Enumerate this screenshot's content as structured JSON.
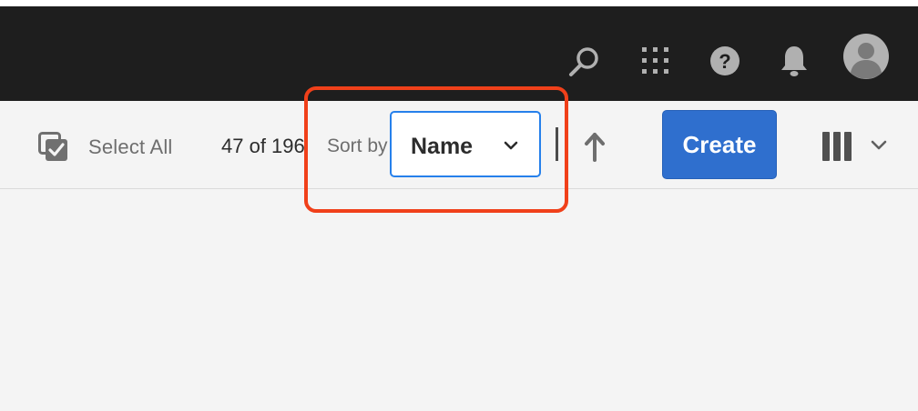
{
  "header": {
    "icons": [
      "search-icon",
      "apps-grid-icon",
      "help-icon",
      "notifications-bell-icon",
      "user-avatar-icon"
    ]
  },
  "toolbar": {
    "select_all_label": "Select All",
    "item_count": "47 of 196",
    "sort_by_label": "Sort by",
    "sort_value": "Name",
    "sort_direction": "ascending",
    "create_label": "Create",
    "view_mode": "column-view"
  },
  "colors": {
    "header_bg": "#1e1e1e",
    "toolbar_bg": "#f4f4f4",
    "primary_button": "#2f6fce",
    "dropdown_focus": "#2680eb",
    "highlight_annotation": "#f0401a"
  }
}
